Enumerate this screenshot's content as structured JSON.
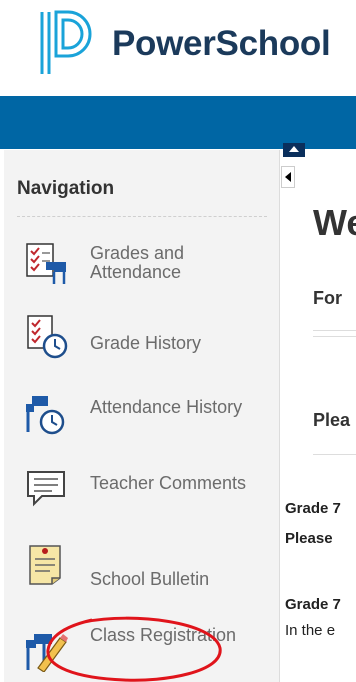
{
  "brand": {
    "name": "PowerSchool",
    "logo_color": "#1aa3d9",
    "topbar_color": "#0066a4"
  },
  "sidebar": {
    "title": "Navigation",
    "items": [
      {
        "label": "Grades and Attendance",
        "icon": "grades-attendance-icon"
      },
      {
        "label": "Grade History",
        "icon": "grade-history-icon"
      },
      {
        "label": "Attendance History",
        "icon": "attendance-history-icon"
      },
      {
        "label": "Teacher Comments",
        "icon": "teacher-comments-icon"
      },
      {
        "label": "School Bulletin",
        "icon": "school-bulletin-icon"
      },
      {
        "label": "Class Registration",
        "icon": "class-registration-icon"
      }
    ]
  },
  "main": {
    "heading": "We",
    "subheading_1": "For",
    "subheading_2": "Plea",
    "line_1": "Grade 7",
    "line_2": "Please",
    "line_3": "Grade 7",
    "line_4": "In the e"
  },
  "annotation": {
    "color": "#e0141b"
  }
}
